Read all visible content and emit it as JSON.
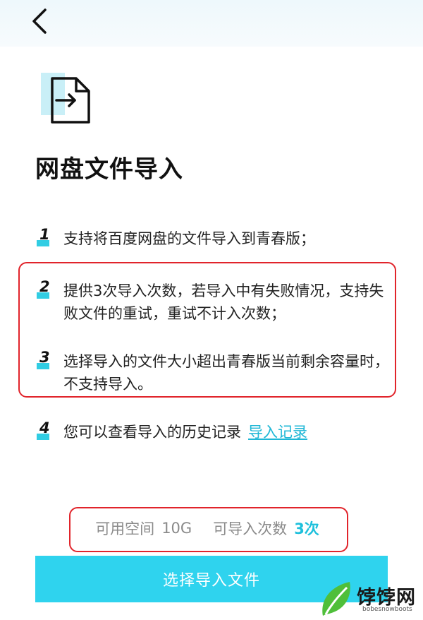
{
  "header": {
    "back_icon": "chevron-left-icon"
  },
  "page": {
    "icon": "file-import-icon",
    "title": "网盘文件导入"
  },
  "rules": [
    {
      "num": "1",
      "text": "支持将百度网盘的文件导入到青春版；"
    },
    {
      "num": "2",
      "text": "提供3次导入次数，若导入中有失败情况，支持失败文件的重试，重试不计入次数；"
    },
    {
      "num": "3",
      "text": "选择导入的文件大小超出青春版当前剩余容量时，不支持导入。"
    },
    {
      "num": "4",
      "text": "您可以查看导入的历史记录",
      "link": "导入记录"
    }
  ],
  "stats": {
    "space_label": "可用空间",
    "space_value": "10G",
    "count_label": "可导入次数",
    "count_value": "3次"
  },
  "action": {
    "button_label": "选择导入文件"
  },
  "watermark": {
    "text": "饽饽网",
    "sub": "bobesnowboots"
  },
  "colors": {
    "accent": "#2fd3ee",
    "highlight_border": "#e1242b",
    "link": "#1fb7d6"
  }
}
